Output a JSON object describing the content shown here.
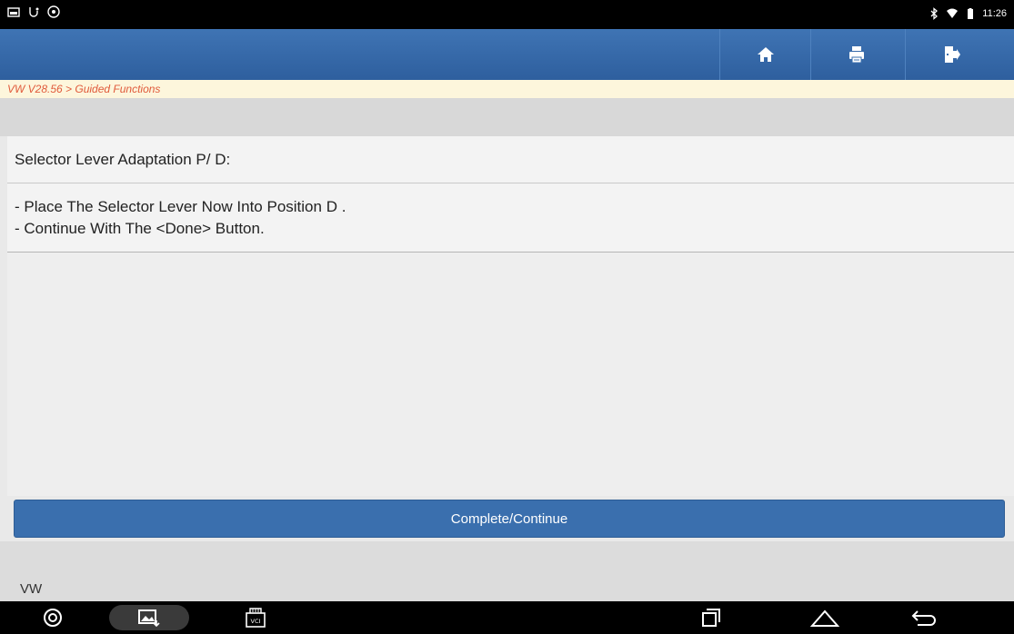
{
  "status_bar": {
    "time": "11:26"
  },
  "toolbar": {
    "buttons": [
      {
        "name": "home-icon"
      },
      {
        "name": "print-icon"
      },
      {
        "name": "exit-icon"
      }
    ]
  },
  "breadcrumb": "VW V28.56 > Guided Functions",
  "content": {
    "title": "Selector Lever Adaptation P/ D:",
    "lines": [
      "- Place The Selector Lever Now Into Position D .",
      "- Continue With The <Done> Button."
    ]
  },
  "actions": {
    "complete_label": "Complete/Continue"
  },
  "footer": {
    "label": "VW"
  },
  "nav": {
    "vci_label": "VCI"
  },
  "colors": {
    "toolbar": "#3a6fae",
    "breadcrumb_text": "#e05a3b",
    "button": "#3a6fae"
  }
}
